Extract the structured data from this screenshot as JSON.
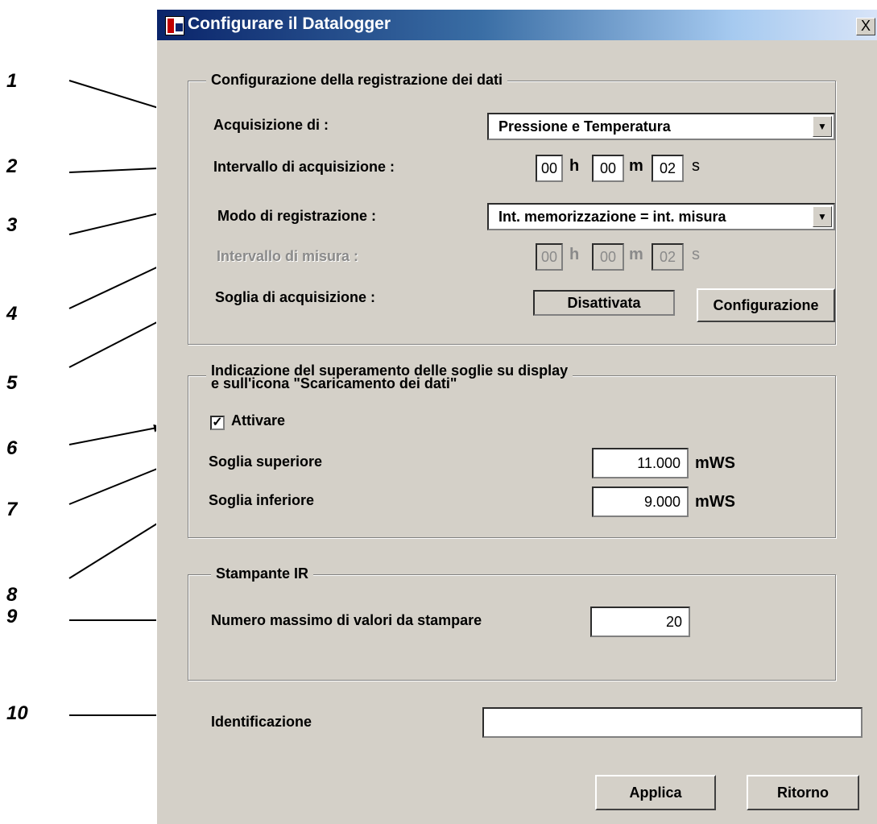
{
  "callouts": [
    "1",
    "2",
    "3",
    "4",
    "5",
    "6",
    "7",
    "8",
    "9",
    "10"
  ],
  "window": {
    "title": "Configurare il Datalogger",
    "close_label": "X",
    "icon": "datalogger-icon"
  },
  "group_recording": {
    "title": "Configurazione della registrazione dei dati",
    "acquisition_label": "Acquisizione di :",
    "acquisition_value": "Pressione e Temperatura",
    "interval_label": "Intervallo di acquisizione :",
    "interval": {
      "h": "00",
      "m": "00",
      "s": "02"
    },
    "units": {
      "h": "h",
      "m": "m",
      "s": "s"
    },
    "mode_label": "Modo di registrazione :",
    "mode_value": "Int. memorizzazione = int. misura",
    "measure_label": "Intervallo di misura :",
    "measure": {
      "h": "00",
      "m": "00",
      "s": "02"
    },
    "threshold_label": "Soglia di acquisizione :",
    "threshold_status": "Disattivata",
    "config_button": "Configurazione"
  },
  "group_thresholds": {
    "title_line1": "Indicazione del superamento delle soglie su display",
    "title_line2": "e sull'icona \"Scaricamento dei dati\"",
    "activate_label": "Attivare",
    "activate_checked": true,
    "upper_label": "Soglia superiore",
    "upper_value": "11.000",
    "lower_label": "Soglia inferiore",
    "lower_value": "9.000",
    "unit": "mWS"
  },
  "group_printer": {
    "title": "Stampante IR",
    "max_label": "Numero massimo di valori da stampare",
    "max_value": "20"
  },
  "identification": {
    "label": "Identificazione",
    "value": ""
  },
  "buttons": {
    "apply": "Applica",
    "back": "Ritorno"
  }
}
